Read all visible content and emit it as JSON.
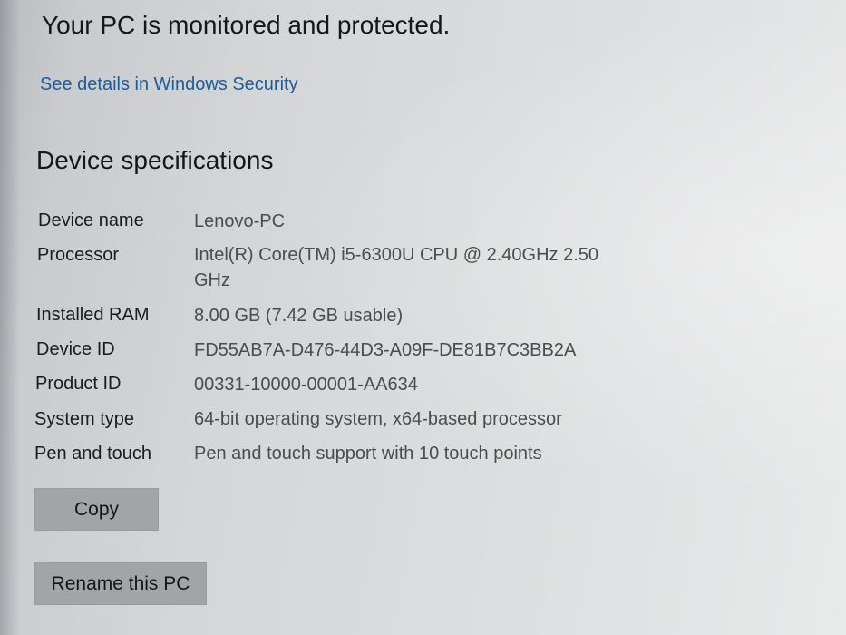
{
  "security": {
    "headline": "Your PC is monitored and protected.",
    "link_text": "See details in Windows Security"
  },
  "device_specs": {
    "title": "Device specifications",
    "rows": [
      {
        "label": "Device name",
        "value": "Lenovo-PC"
      },
      {
        "label": "Processor",
        "value": "Intel(R) Core(TM) i5-6300U CPU @ 2.40GHz   2.50 GHz"
      },
      {
        "label": "Installed RAM",
        "value": "8.00 GB (7.42 GB usable)"
      },
      {
        "label": "Device ID",
        "value": "FD55AB7A-D476-44D3-A09F-DE81B7C3BB2A"
      },
      {
        "label": "Product ID",
        "value": "00331-10000-00001-AA634"
      },
      {
        "label": "System type",
        "value": "64-bit operating system, x64-based processor"
      },
      {
        "label": "Pen and touch",
        "value": "Pen and touch support with 10 touch points"
      }
    ]
  },
  "buttons": {
    "copy_label": "Copy",
    "rename_label": "Rename this PC"
  },
  "colors": {
    "link": "#1f5c99",
    "button_bg": "#a3a4a5"
  }
}
